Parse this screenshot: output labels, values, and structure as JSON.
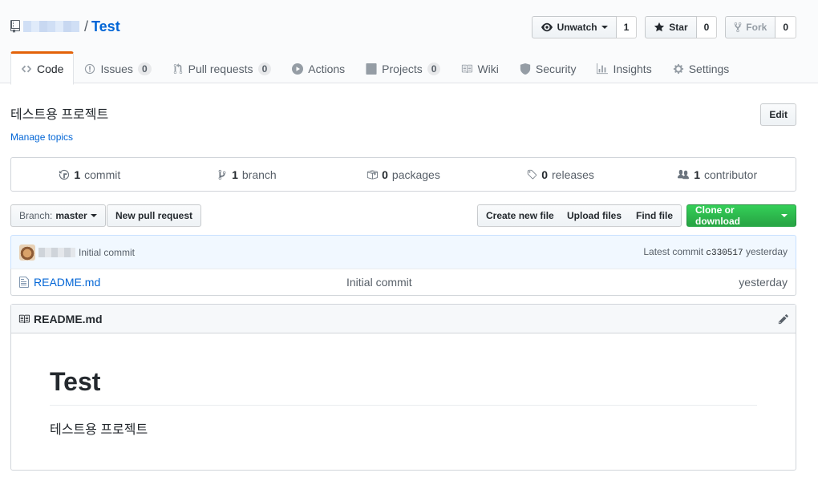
{
  "header": {
    "repo_name": "Test",
    "slash": "/",
    "unwatch_label": "Unwatch",
    "watch_count": "1",
    "star_label": "Star",
    "star_count": "0",
    "fork_label": "Fork",
    "fork_count": "0"
  },
  "tabs": [
    {
      "label": "Code",
      "icon": "code-icon"
    },
    {
      "label": "Issues",
      "count": "0",
      "icon": "issue-icon"
    },
    {
      "label": "Pull requests",
      "count": "0",
      "icon": "pull-request-icon"
    },
    {
      "label": "Actions",
      "icon": "play-icon"
    },
    {
      "label": "Projects",
      "count": "0",
      "icon": "project-icon"
    },
    {
      "label": "Wiki",
      "icon": "book-icon"
    },
    {
      "label": "Security",
      "icon": "shield-icon"
    },
    {
      "label": "Insights",
      "icon": "graph-icon"
    },
    {
      "label": "Settings",
      "icon": "gear-icon"
    }
  ],
  "repo": {
    "description": "테스트용 프로젝트",
    "manage_topics": "Manage topics",
    "edit_label": "Edit"
  },
  "summary": {
    "commits_count": "1",
    "commits_label": "commit",
    "branches_count": "1",
    "branches_label": "branch",
    "packages_count": "0",
    "packages_label": "packages",
    "releases_count": "0",
    "releases_label": "releases",
    "contributors_count": "1",
    "contributors_label": "contributor"
  },
  "file_nav": {
    "branch_prefix": "Branch:",
    "branch_name": "master",
    "new_pr": "New pull request",
    "create_file": "Create new file",
    "upload_files": "Upload files",
    "find_file": "Find file",
    "clone": "Clone or download"
  },
  "commit": {
    "message": "Initial commit",
    "latest_prefix": "Latest commit",
    "sha": "c330517",
    "age": "yesterday"
  },
  "files": [
    {
      "name": "README.md",
      "message": "Initial commit",
      "age": "yesterday"
    }
  ],
  "readme": {
    "filename": "README.md",
    "heading": "Test",
    "body": "테스트용 프로젝트"
  },
  "colors": {
    "link": "#0366d6",
    "tab_accent": "#e36209",
    "green_button": "#28a745",
    "commit_bar_bg": "#f1f8ff"
  }
}
